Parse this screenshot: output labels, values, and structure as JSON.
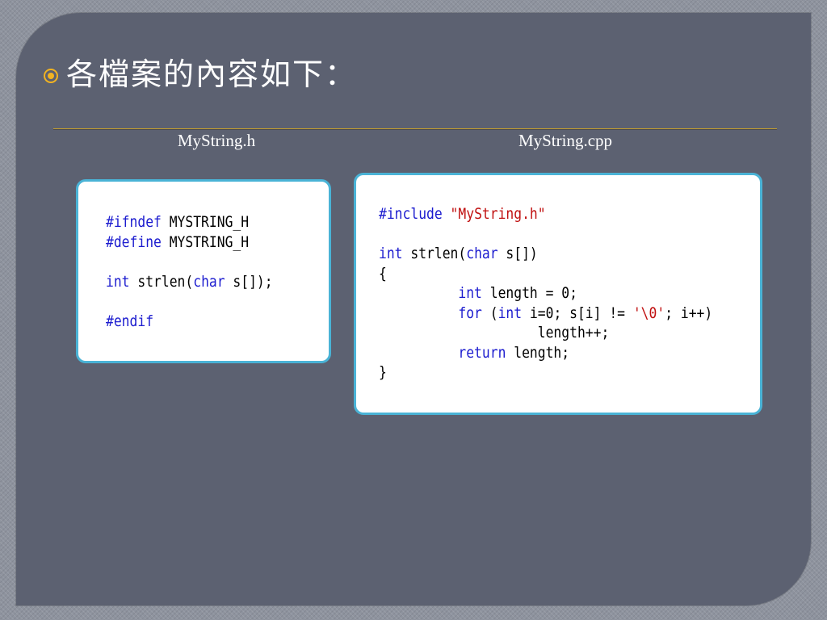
{
  "slide": {
    "heading": "各檔案的內容如下：",
    "colors": {
      "panel": "#5c6171",
      "bullet": "#f2b321",
      "card_border": "#4ab3d6",
      "keyword": "#1c1ccf",
      "string": "#c01010"
    }
  },
  "files": [
    {
      "label": "MyString.h",
      "lines": [
        [
          {
            "t": "#ifndef",
            "k": "kw"
          },
          {
            "t": " MYSTRING_H",
            "k": ""
          }
        ],
        [
          {
            "t": "#define",
            "k": "kw"
          },
          {
            "t": " MYSTRING_H",
            "k": ""
          }
        ],
        [],
        [
          {
            "t": "int",
            "k": "kw"
          },
          {
            "t": " strlen(",
            "k": ""
          },
          {
            "t": "char",
            "k": "kw"
          },
          {
            "t": " s[]);",
            "k": ""
          }
        ],
        [],
        [
          {
            "t": "#endif",
            "k": "kw"
          }
        ]
      ]
    },
    {
      "label": "MyString.cpp",
      "lines": [
        [
          {
            "t": "#include",
            "k": "kw"
          },
          {
            "t": " ",
            "k": ""
          },
          {
            "t": "\"MyString.h\"",
            "k": "str"
          }
        ],
        [],
        [
          {
            "t": "int",
            "k": "kw"
          },
          {
            "t": " strlen(",
            "k": ""
          },
          {
            "t": "char",
            "k": "kw"
          },
          {
            "t": " s[])",
            "k": ""
          }
        ],
        [
          {
            "t": "{",
            "k": ""
          }
        ],
        [
          {
            "t": "          ",
            "k": ""
          },
          {
            "t": "int",
            "k": "kw"
          },
          {
            "t": " length = 0;",
            "k": ""
          }
        ],
        [
          {
            "t": "          ",
            "k": ""
          },
          {
            "t": "for",
            "k": "kw"
          },
          {
            "t": " (",
            "k": ""
          },
          {
            "t": "int",
            "k": "kw"
          },
          {
            "t": " i=0; s[i] != ",
            "k": ""
          },
          {
            "t": "'\\0'",
            "k": "str"
          },
          {
            "t": "; i++)",
            "k": ""
          }
        ],
        [
          {
            "t": "                    length++;",
            "k": ""
          }
        ],
        [
          {
            "t": "          ",
            "k": ""
          },
          {
            "t": "return",
            "k": "kw"
          },
          {
            "t": " length;",
            "k": ""
          }
        ],
        [
          {
            "t": "}",
            "k": ""
          }
        ]
      ]
    }
  ]
}
